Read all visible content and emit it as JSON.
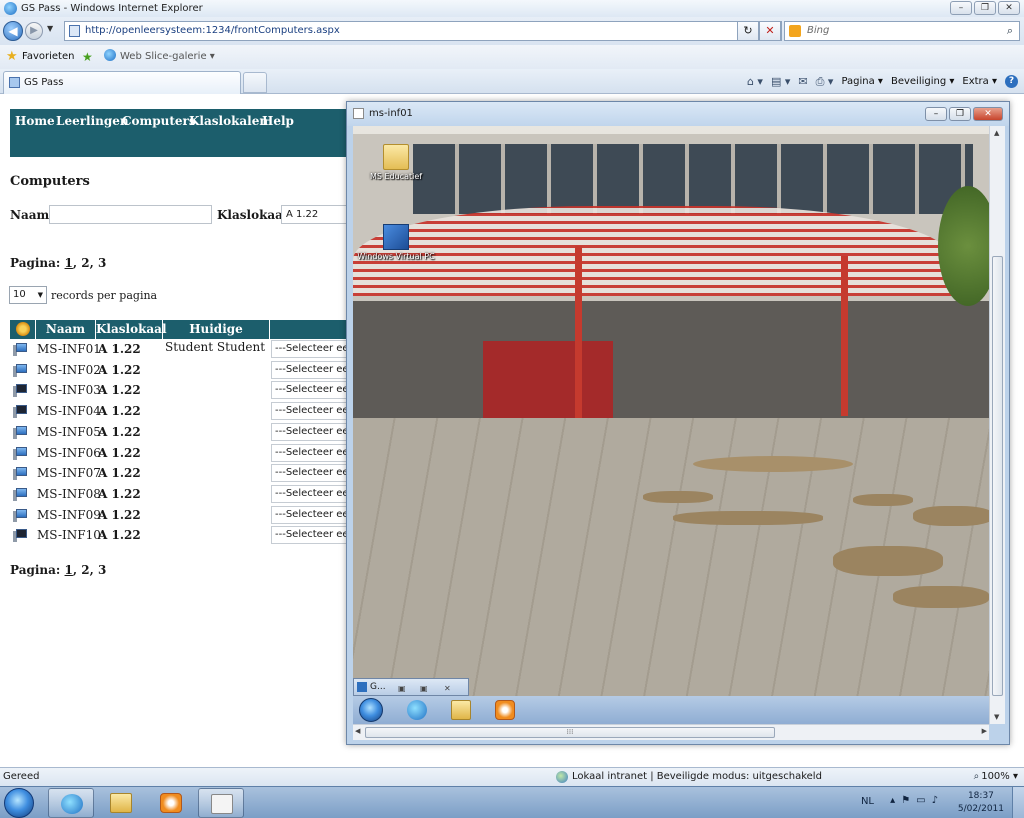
{
  "browser": {
    "window_title": "GS Pass - Windows Internet Explorer",
    "address": "http://openleersysteem:1234/frontComputers.aspx",
    "search_placeholder": "Bing",
    "favorites_label": "Favorieten",
    "webslice_label": "Web Slice-galerie",
    "tab_title": "GS Pass",
    "cmd": {
      "page": "Pagina",
      "security": "Beveiliging",
      "extra": "Extra"
    },
    "status_ready": "Gereed",
    "status_zone": "Lokaal intranet | Beveiligde modus: uitgeschakeld",
    "zoom": "100%"
  },
  "site": {
    "nav": [
      "Home",
      "Leerlingen",
      "Computers",
      "Klaslokalen",
      "Help"
    ],
    "heading": "Computers",
    "filter": {
      "naam_label": "Naam:",
      "naam_value": "",
      "klaslokaal_label": "Klaslokaal:",
      "klaslokaal_value": "A 1.22"
    },
    "pagination": {
      "label": "Pagina:",
      "pages": [
        "1",
        "2",
        "3"
      ]
    },
    "records_per_page": {
      "value": "10",
      "label": "records per pagina"
    },
    "grid": {
      "columns": [
        "Naam",
        "Klaslokaal",
        "Huidige gebruiker"
      ],
      "rows": [
        {
          "naam": "MS-INF01",
          "klaslokaal": "A 1.22",
          "gebruiker": "Student Student",
          "select": "---Selecteer een",
          "icon": "pc-icon"
        },
        {
          "naam": "MS-INF02",
          "klaslokaal": "A 1.22",
          "gebruiker": "",
          "select": "---Selecteer een",
          "icon": "pc-icon"
        },
        {
          "naam": "MS-INF03",
          "klaslokaal": "A 1.22",
          "gebruiker": "",
          "select": "---Selecteer een",
          "icon": "pc-off-icon"
        },
        {
          "naam": "MS-INF04",
          "klaslokaal": "A 1.22",
          "gebruiker": "",
          "select": "---Selecteer een",
          "icon": "pc-off-icon"
        },
        {
          "naam": "MS-INF05",
          "klaslokaal": "A 1.22",
          "gebruiker": "",
          "select": "---Selecteer een",
          "icon": "pc-icon"
        },
        {
          "naam": "MS-INF06",
          "klaslokaal": "A 1.22",
          "gebruiker": "",
          "select": "---Selecteer een",
          "icon": "pc-icon"
        },
        {
          "naam": "MS-INF07",
          "klaslokaal": "A 1.22",
          "gebruiker": "",
          "select": "---Selecteer een",
          "icon": "pc-icon"
        },
        {
          "naam": "MS-INF08",
          "klaslokaal": "A 1.22",
          "gebruiker": "",
          "select": "---Selecteer een",
          "icon": "pc-icon"
        },
        {
          "naam": "MS-INF09",
          "klaslokaal": "A 1.22",
          "gebruiker": "",
          "select": "---Selecteer een",
          "icon": "pc-icon"
        },
        {
          "naam": "MS-INF10",
          "klaslokaal": "A 1.22",
          "gebruiker": "",
          "select": "---Selecteer een",
          "icon": "pc-off-icon"
        }
      ]
    }
  },
  "vm": {
    "title": "ms-inf01",
    "desktop_icons": [
      "MS Educatief",
      "Windows Virtual PC"
    ],
    "minibar_label": "G..."
  },
  "taskbar": {
    "lang": "NL",
    "time": "18:37",
    "date": "5/02/2011"
  },
  "colors": {
    "site_nav": "#1c5e6c",
    "canopy_red": "#c8332b"
  }
}
